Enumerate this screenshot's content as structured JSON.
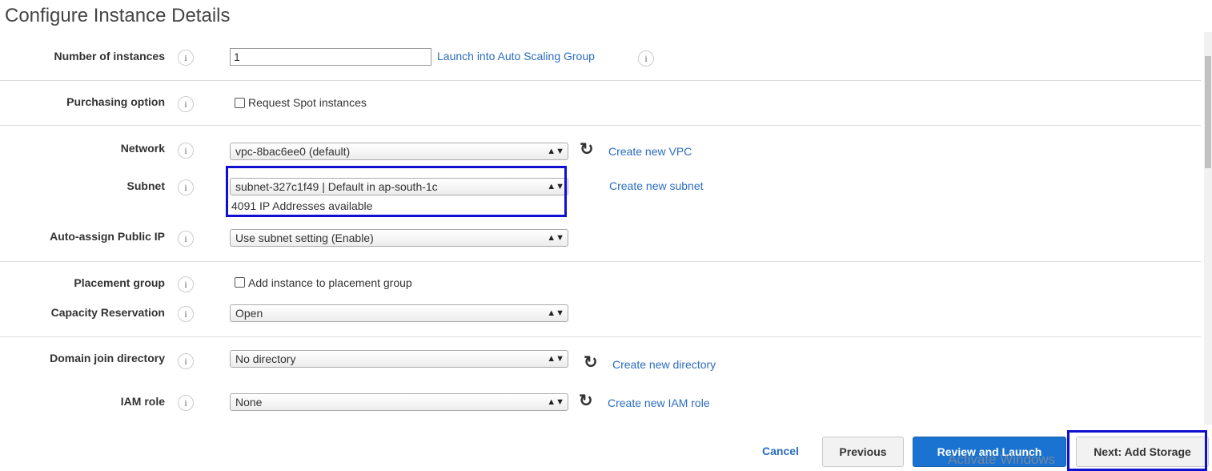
{
  "page": {
    "title": "Configure Instance Details"
  },
  "fields": {
    "instances": {
      "label": "Number of instances",
      "value": "1",
      "link": "Launch into Auto Scaling Group"
    },
    "purchasing": {
      "label": "Purchasing option",
      "checkbox_label": "Request Spot instances",
      "checked": false
    },
    "network": {
      "label": "Network",
      "value": "vpc-8bac6ee0 (default)",
      "link": "Create new VPC"
    },
    "subnet": {
      "label": "Subnet",
      "value": "subnet-327c1f49 | Default in ap-south-1c",
      "available": "4091 IP Addresses available",
      "link": "Create new subnet"
    },
    "public_ip": {
      "label": "Auto-assign Public IP",
      "value": "Use subnet setting (Enable)"
    },
    "placement": {
      "label": "Placement group",
      "checkbox_label": "Add instance to placement group",
      "checked": false
    },
    "capacity": {
      "label": "Capacity Reservation",
      "value": "Open"
    },
    "domain": {
      "label": "Domain join directory",
      "value": "No directory",
      "link": "Create new directory"
    },
    "iam": {
      "label": "IAM role",
      "value": "None",
      "link": "Create new IAM role"
    }
  },
  "footer": {
    "cancel": "Cancel",
    "previous": "Previous",
    "review": "Review and Launch",
    "next": "Next: Add Storage"
  },
  "watermark": "Activate Windows",
  "icons": {
    "info": "info-icon",
    "refresh": "refresh-icon",
    "dropdown": "dropdown-arrow-icon"
  },
  "colors": {
    "link": "#2b6cbf",
    "primary_button": "#1a73d1",
    "highlight": "#1010d0"
  }
}
